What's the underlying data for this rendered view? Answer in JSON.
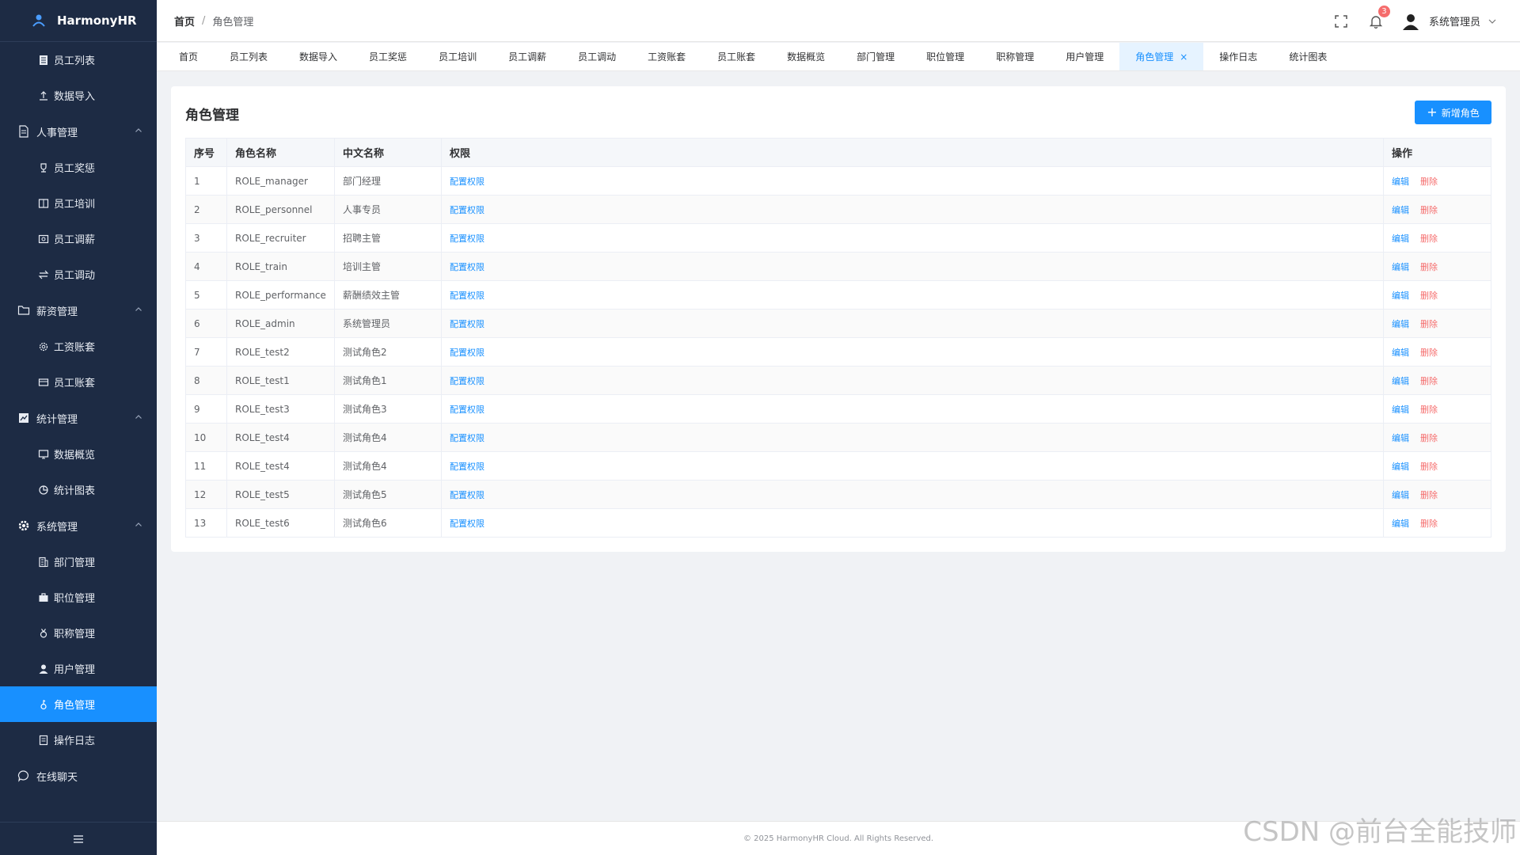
{
  "app": {
    "name": "HarmonyHR"
  },
  "sidebar": {
    "items": [
      {
        "type": "item",
        "label": "员工列表",
        "icon": "list-icon"
      },
      {
        "type": "item",
        "label": "数据导入",
        "icon": "upload-icon"
      },
      {
        "type": "group",
        "label": "人事管理",
        "icon": "document-icon",
        "expanded": true
      },
      {
        "type": "item",
        "label": "员工奖惩",
        "icon": "trophy-icon"
      },
      {
        "type": "item",
        "label": "员工培训",
        "icon": "book-icon"
      },
      {
        "type": "item",
        "label": "员工调薪",
        "icon": "money-icon"
      },
      {
        "type": "item",
        "label": "员工调动",
        "icon": "transfer-icon"
      },
      {
        "type": "group",
        "label": "薪资管理",
        "icon": "folder-icon",
        "expanded": true
      },
      {
        "type": "item",
        "label": "工资账套",
        "icon": "gear-icon"
      },
      {
        "type": "item",
        "label": "员工账套",
        "icon": "card-icon"
      },
      {
        "type": "group",
        "label": "统计管理",
        "icon": "chart-icon",
        "expanded": true
      },
      {
        "type": "item",
        "label": "数据概览",
        "icon": "monitor-icon"
      },
      {
        "type": "item",
        "label": "统计图表",
        "icon": "pie-chart-icon"
      },
      {
        "type": "group",
        "label": "系统管理",
        "icon": "settings-icon",
        "expanded": true
      },
      {
        "type": "item",
        "label": "部门管理",
        "icon": "building-icon"
      },
      {
        "type": "item",
        "label": "职位管理",
        "icon": "briefcase-icon"
      },
      {
        "type": "item",
        "label": "职称管理",
        "icon": "medal-icon"
      },
      {
        "type": "item",
        "label": "用户管理",
        "icon": "user-icon"
      },
      {
        "type": "item",
        "label": "角色管理",
        "icon": "role-icon",
        "active": true
      },
      {
        "type": "item",
        "label": "操作日志",
        "icon": "log-icon"
      },
      {
        "type": "standalone",
        "label": "在线聊天",
        "icon": "chat-icon"
      }
    ]
  },
  "header": {
    "breadcrumb": {
      "home": "首页",
      "separator": "/",
      "current": "角色管理"
    },
    "notification_count": "3",
    "username": "系统管理员"
  },
  "tabs": [
    {
      "label": "首页"
    },
    {
      "label": "员工列表"
    },
    {
      "label": "数据导入"
    },
    {
      "label": "员工奖惩"
    },
    {
      "label": "员工培训"
    },
    {
      "label": "员工调薪"
    },
    {
      "label": "员工调动"
    },
    {
      "label": "工资账套"
    },
    {
      "label": "员工账套"
    },
    {
      "label": "数据概览"
    },
    {
      "label": "部门管理"
    },
    {
      "label": "职位管理"
    },
    {
      "label": "职称管理"
    },
    {
      "label": "用户管理"
    },
    {
      "label": "角色管理",
      "active": true,
      "close": "×"
    },
    {
      "label": "操作日志"
    },
    {
      "label": "统计图表"
    }
  ],
  "main": {
    "title": "角色管理",
    "add_button": "新增角色",
    "columns": [
      "序号",
      "角色名称",
      "中文名称",
      "权限",
      "操作"
    ],
    "actions": {
      "permission": "配置权限",
      "edit": "编辑",
      "delete": "删除"
    },
    "rows": [
      {
        "index": "1",
        "name": "ROLE_manager",
        "cn": "部门经理"
      },
      {
        "index": "2",
        "name": "ROLE_personnel",
        "cn": "人事专员"
      },
      {
        "index": "3",
        "name": "ROLE_recruiter",
        "cn": "招聘主管"
      },
      {
        "index": "4",
        "name": "ROLE_train",
        "cn": "培训主管"
      },
      {
        "index": "5",
        "name": "ROLE_performance",
        "cn": "薪酬绩效主管"
      },
      {
        "index": "6",
        "name": "ROLE_admin",
        "cn": "系统管理员"
      },
      {
        "index": "7",
        "name": "ROLE_test2",
        "cn": "测试角色2"
      },
      {
        "index": "8",
        "name": "ROLE_test1",
        "cn": "测试角色1"
      },
      {
        "index": "9",
        "name": "ROLE_test3",
        "cn": "测试角色3"
      },
      {
        "index": "10",
        "name": "ROLE_test4",
        "cn": "测试角色4"
      },
      {
        "index": "11",
        "name": "ROLE_test4",
        "cn": "测试角色4"
      },
      {
        "index": "12",
        "name": "ROLE_test5",
        "cn": "测试角色5"
      },
      {
        "index": "13",
        "name": "ROLE_test6",
        "cn": "测试角色6"
      }
    ]
  },
  "footer": {
    "text": "© 2025 HarmonyHR Cloud. All Rights Reserved."
  },
  "watermark": "CSDN @前台全能技师",
  "colors": {
    "sidebar_bg": "#1d2b44",
    "accent": "#1890ff",
    "danger": "#f56c6c"
  }
}
